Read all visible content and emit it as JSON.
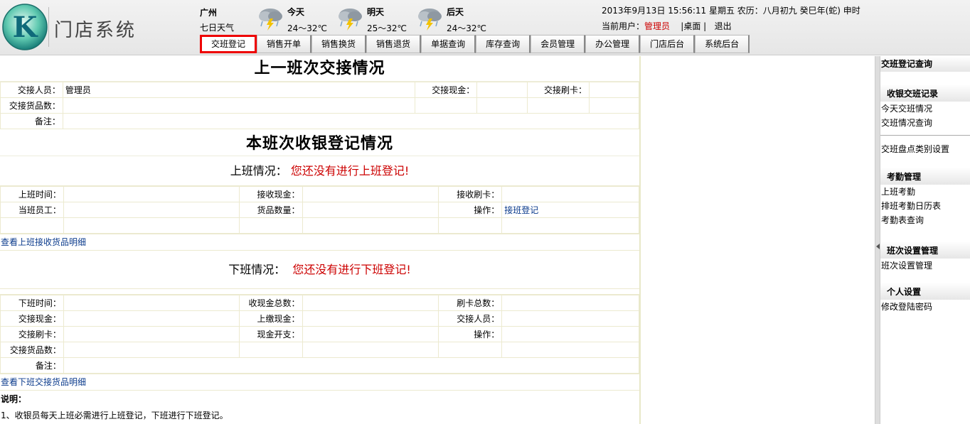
{
  "app": {
    "logo_letter": "K",
    "name": "门店系统"
  },
  "weather": {
    "city": "广州",
    "seven_day": "七日天气",
    "days": [
      {
        "day": "今天",
        "temp": "24～32℃"
      },
      {
        "day": "明天",
        "temp": "25～32℃"
      },
      {
        "day": "后天",
        "temp": "24～32℃"
      }
    ]
  },
  "topbar": {
    "datetime": "2013年9月13日  15:56:11 星期五  农历：八月初九  癸巳年(蛇) 申时",
    "user_prefix": "当前用户：",
    "user_name": "管理员",
    "desktop": "|桌面 |",
    "logout": "退出"
  },
  "nav": {
    "tabs": [
      "交班登记",
      "销售开单",
      "销售换货",
      "销售退货",
      "单据查询",
      "库存查询",
      "会员管理",
      "办公管理",
      "门店后台",
      "系统后台"
    ],
    "active_index": 0
  },
  "prev_shift": {
    "title": "上一班次交接情况",
    "handover_person_label": "交接人员：",
    "handover_person_value": "管理员",
    "handover_cash_label": "交接现金：",
    "handover_card_label": "交接刷卡：",
    "handover_goods_label": "交接货品数：",
    "remark_label": "备注："
  },
  "current_shift": {
    "title": "本班次收银登记情况",
    "on_duty_label": "上班情况：",
    "on_duty_status": "您还没有进行上班登记!",
    "on_time_label": "上班时间：",
    "recv_cash_label": "接收现金：",
    "recv_card_label": "接收刷卡：",
    "staff_label": "当班员工：",
    "goods_qty_label": "货品数量：",
    "op_label": "操作：",
    "op_link": "接班登记",
    "view_on_goods_link": "查看上班接收货品明细",
    "off_duty_label": "下班情况：",
    "off_duty_status": "您还没有进行下班登记!",
    "off_time_label": "下班时间：",
    "cash_total_label": "收现金总数：",
    "card_total_label": "刷卡总数：",
    "handover_cash_label": "交接现金：",
    "paid_cash_label": "上缴现金：",
    "handover_person_label": "交接人员：",
    "handover_card_label": "交接刷卡：",
    "cash_expense_label": "现金开支：",
    "op2_label": "操作：",
    "handover_goods_label": "交接货品数：",
    "remark_label": "备注：",
    "view_off_goods_link": "查看下班交接货品明细"
  },
  "notes": {
    "title": "说明：",
    "items": [
      "1、收银员每天上班必需进行上班登记，下班进行下班登记。"
    ]
  },
  "sidebar": {
    "header": "交班登记查询",
    "groups": [
      {
        "title": "收银交班记录",
        "items": [
          "今天交班情况",
          "交班情况查询"
        ]
      },
      {
        "title": "",
        "items": [
          "交班盘点类别设置"
        ]
      },
      {
        "title": "考勤管理",
        "items": [
          "上班考勤",
          "排班考勤日历表",
          "考勤表查询"
        ]
      },
      {
        "title": "班次设置管理",
        "items": [
          "班次设置管理"
        ]
      },
      {
        "title": "个人设置",
        "items": [
          "修改登陆密码"
        ]
      }
    ]
  },
  "colors": {
    "warning": "#cc0000",
    "link": "#0b3b8c",
    "active_tab_border": "#ee0000",
    "logo_teal": "#1a8a8a"
  },
  "icons": [
    "logo-k",
    "thunderstorm-cloud-icon",
    "collapse-arrow-icon"
  ]
}
